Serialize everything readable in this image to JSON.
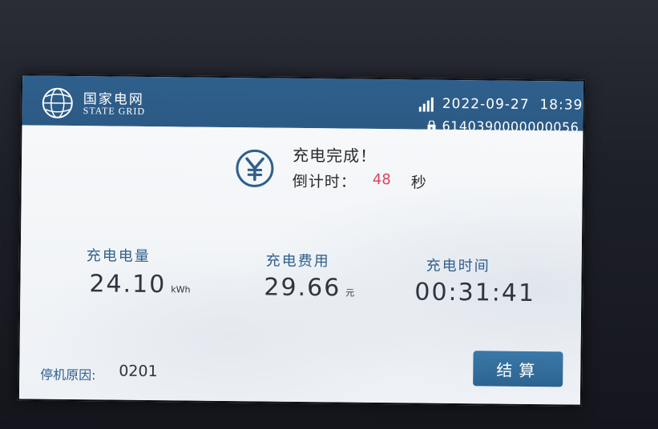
{
  "header": {
    "brand_cn": "国家电网",
    "brand_en": "State Grid",
    "datetime": "2022-09-27  18:39",
    "device_id": "6140390000000056",
    "icons": {
      "logo": "state-grid-logo",
      "signal": "signal-strength-icon",
      "lock": "lock-icon"
    }
  },
  "status": {
    "title": "充电完成！",
    "countdown_label": "倒计时：",
    "countdown_value": "48",
    "countdown_unit": "秒",
    "icon": "yen-icon",
    "countdown_color": "#e0405a"
  },
  "metrics": [
    {
      "label": "充电电量",
      "value": "24.10",
      "unit": "kWh"
    },
    {
      "label": "充电费用",
      "value": "29.66",
      "unit": "元"
    },
    {
      "label": "充电时间",
      "value": "00:31:41",
      "unit": ""
    }
  ],
  "footer": {
    "stop_reason_label": "停机原因:",
    "stop_reason_value": "0201",
    "settle_button_label": "结算"
  },
  "colors": {
    "header_bg": "#2f5f8c",
    "accent": "#2f5f8c",
    "button_bg": "#3b78a8",
    "text_dark": "#2d3540"
  }
}
